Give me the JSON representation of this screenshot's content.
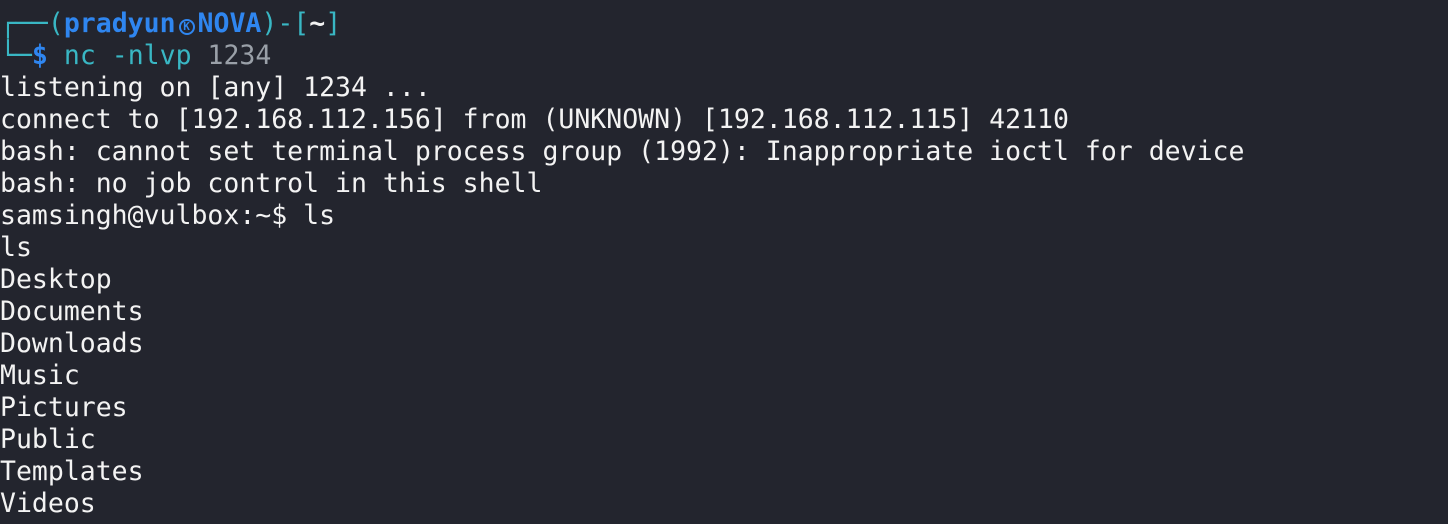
{
  "prompt": {
    "corner_top": "┌──",
    "open_paren": "(",
    "user": "pradyun",
    "icon_glyph": "K",
    "host": "NOVA",
    "close_dash": ")-[",
    "cwd": "~",
    "close_bracket": "]",
    "corner_bottom": "└─",
    "dollar": "$",
    "command_name": "nc",
    "command_flag": "-nlvp",
    "command_port": "1234"
  },
  "output": [
    "listening on [any] 1234 ...",
    "connect to [192.168.112.156] from (UNKNOWN) [192.168.112.115] 42110",
    "bash: cannot set terminal process group (1992): Inappropriate ioctl for device",
    "bash: no job control in this shell",
    "samsingh@vulbox:~$ ls",
    "ls",
    "Desktop",
    "Documents",
    "Downloads",
    "Music",
    "Pictures",
    "Public",
    "Templates",
    "Videos"
  ],
  "colors": {
    "background": "#23252e",
    "foreground": "#f3f3f3",
    "accent_teal": "#39b7c4",
    "accent_blue": "#2f86f0",
    "dim": "#9aa0a8"
  }
}
